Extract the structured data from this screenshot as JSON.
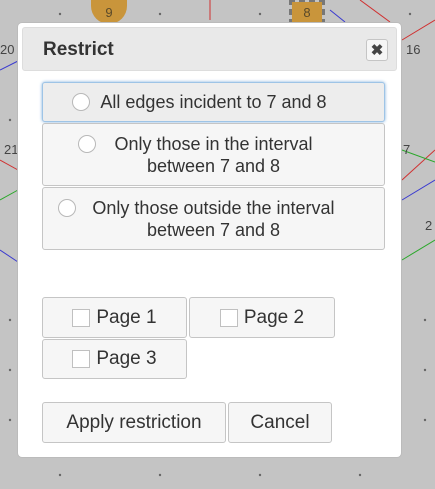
{
  "background": {
    "nodes": [
      {
        "label": "9"
      },
      {
        "label": "8",
        "selected": true
      }
    ],
    "edge_labels": [
      "20",
      "16",
      "21",
      "7",
      "2"
    ]
  },
  "dialog": {
    "title": "Restrict",
    "close_icon": "close-icon",
    "options": [
      {
        "label": "All edges incident to 7 and 8",
        "active": true
      },
      {
        "label": "Only those in the interval between 7 and 8"
      },
      {
        "label": "Only those outside the interval between 7 and 8"
      }
    ],
    "pages": [
      {
        "label": "Page 1"
      },
      {
        "label": "Page 2"
      },
      {
        "label": "Page 3"
      }
    ],
    "apply_label": "Apply restriction",
    "cancel_label": "Cancel"
  },
  "colors": {
    "accent": "#9ec4e6",
    "node": "#c9953b"
  }
}
